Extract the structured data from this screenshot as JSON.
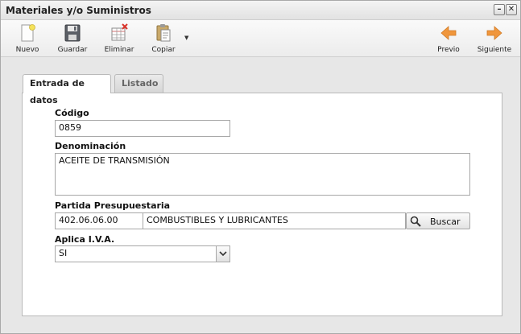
{
  "window": {
    "title": "Materiales y/o Suministros",
    "minimize": "–",
    "close": "✕"
  },
  "toolbar": {
    "nuevo": "Nuevo",
    "guardar": "Guardar",
    "eliminar": "Eliminar",
    "copiar": "Copiar",
    "dropdown": "▼",
    "previo": "Previo",
    "siguiente": "Siguiente"
  },
  "tabs": [
    {
      "label": "Entrada de datos",
      "active": true
    },
    {
      "label": "Listado",
      "active": false
    }
  ],
  "form": {
    "codigo": {
      "label": "Código",
      "value": "0859"
    },
    "denominacion": {
      "label": "Denominación",
      "value": "ACEITE DE TRANSMISIÓN"
    },
    "partida": {
      "label": "Partida Presupuestaria",
      "code": "402.06.06.00",
      "description": "COMBUSTIBLES Y LUBRICANTES",
      "search_label": "Buscar"
    },
    "iva": {
      "label": "Aplica I.V.A.",
      "value": "SI"
    }
  },
  "colors": {
    "arrow": "#f0963c",
    "accent_red": "#d9342b"
  }
}
